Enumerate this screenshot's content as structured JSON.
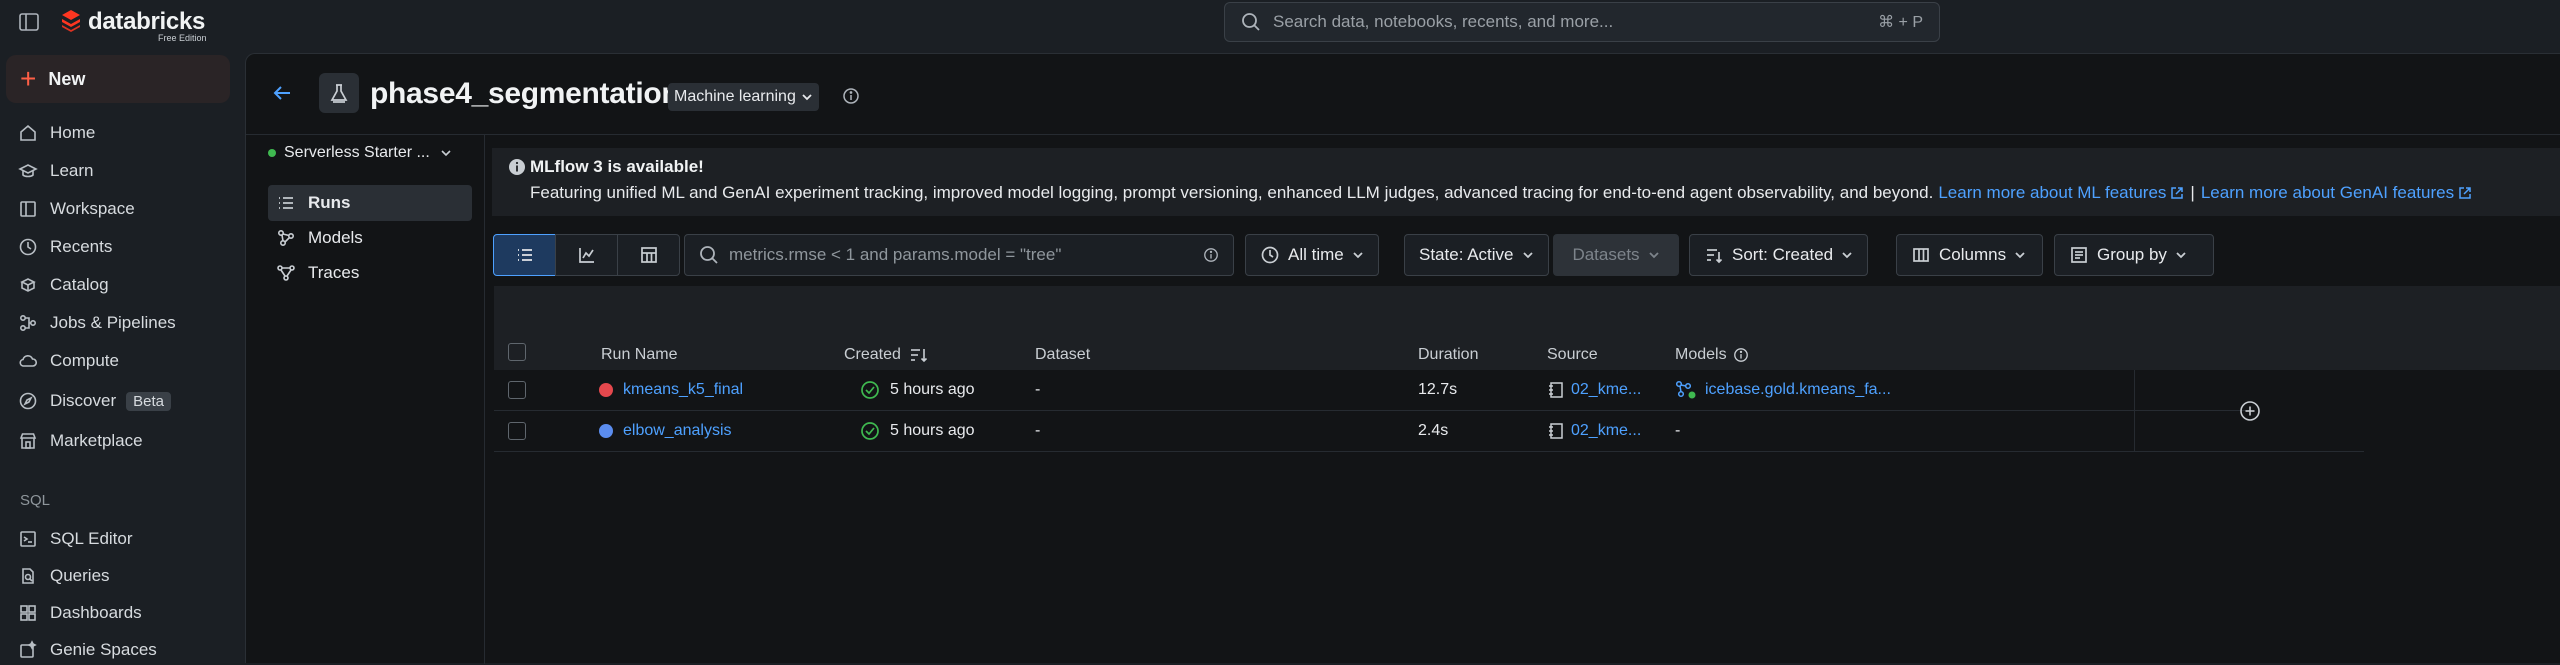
{
  "topbar": {
    "logo_text": "databricks",
    "logo_sub": "Free Edition",
    "search_placeholder": "Search data, notebooks, recents, and more...",
    "search_shortcut": "⌘ + P"
  },
  "sidebar": {
    "new_label": "New",
    "items": [
      {
        "label": "Home",
        "icon": "home-icon"
      },
      {
        "label": "Learn",
        "icon": "learn-icon"
      },
      {
        "label": "Workspace",
        "icon": "workspace-icon"
      },
      {
        "label": "Recents",
        "icon": "clock-icon"
      },
      {
        "label": "Catalog",
        "icon": "catalog-icon"
      },
      {
        "label": "Jobs & Pipelines",
        "icon": "jobs-icon"
      },
      {
        "label": "Compute",
        "icon": "cloud-icon"
      },
      {
        "label": "Discover",
        "icon": "compass-icon",
        "badge": "Beta"
      },
      {
        "label": "Marketplace",
        "icon": "store-icon"
      }
    ],
    "sql_section": "SQL",
    "sql_items": [
      {
        "label": "SQL Editor",
        "icon": "sql-editor-icon"
      },
      {
        "label": "Queries",
        "icon": "queries-icon"
      },
      {
        "label": "Dashboards",
        "icon": "dashboards-icon"
      },
      {
        "label": "Genie Spaces",
        "icon": "genie-icon"
      }
    ]
  },
  "header": {
    "title": "phase4_segmentation",
    "type_label": "Machine learning"
  },
  "subnav": {
    "compute": "Serverless Starter ...",
    "items": [
      {
        "label": "Runs",
        "icon": "list-icon"
      },
      {
        "label": "Models",
        "icon": "models-icon"
      },
      {
        "label": "Traces",
        "icon": "traces-icon"
      }
    ]
  },
  "banner": {
    "title": "MLflow 3 is available!",
    "body": "Featuring unified ML and GenAI experiment tracking, improved model logging, prompt versioning, enhanced LLM judges, advanced tracing for end-to-end agent observability, and beyond.",
    "link1": "Learn more about ML features",
    "separator": "|",
    "link2": "Learn more about GenAI features"
  },
  "toolbar": {
    "filter_placeholder": "metrics.rmse < 1 and params.model = \"tree\"",
    "time": "All time",
    "state": "State: Active",
    "datasets": "Datasets",
    "sort": "Sort: Created",
    "columns": "Columns",
    "group_by": "Group by"
  },
  "table": {
    "columns": [
      "Run Name",
      "Created",
      "Dataset",
      "Duration",
      "Source",
      "Models"
    ],
    "rows": [
      {
        "name": "kmeans_k5_final",
        "color": "#e5484d",
        "created": "5 hours ago",
        "dataset": "-",
        "duration": "12.7s",
        "source": "02_kme...",
        "model": "icebase.gold.kmeans_fa..."
      },
      {
        "name": "elbow_analysis",
        "color": "#5b8def",
        "created": "5 hours ago",
        "dataset": "-",
        "duration": "2.4s",
        "source": "02_kme...",
        "model": "-"
      }
    ]
  },
  "colors": {
    "accent": "#4ea1ff",
    "brand": "#ff3621",
    "success": "#3fb950"
  }
}
